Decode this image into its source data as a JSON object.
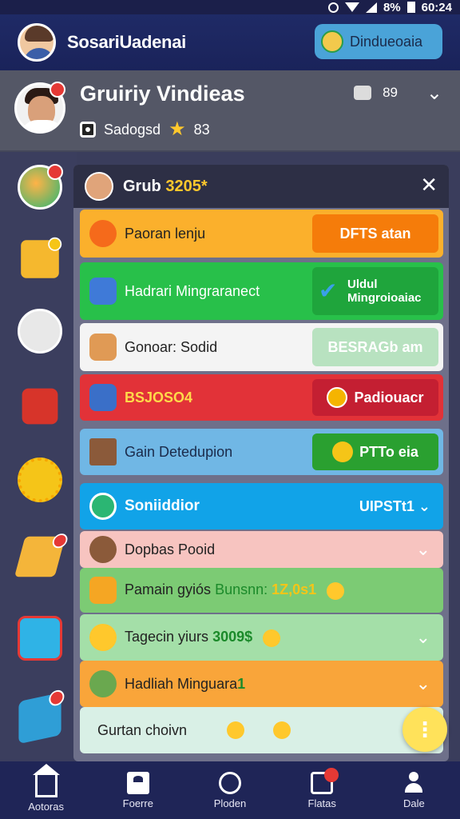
{
  "status_bar": {
    "battery": "8%",
    "time": "60:24"
  },
  "header": {
    "title": "SosariUadenai",
    "button_label": "Dindueoaia"
  },
  "profile": {
    "name": "Gruiriy Vindieas",
    "subtitle": "Sadogsd",
    "star_count": "83",
    "points": "89"
  },
  "panel": {
    "title_prefix": "Grub",
    "title_value": "3205*",
    "rows": [
      {
        "label": "Paoran lenju",
        "action": "DFTS atan"
      },
      {
        "label": "Hadrari Mingraranect",
        "action": "Uldul Mingroioaiac"
      },
      {
        "label": "Gonoar: Sodid",
        "action": "BESRAGb am"
      },
      {
        "label": "BSJOSO4",
        "action": "Padiouacr"
      },
      {
        "label": "Gain Detedupion",
        "action": "PTTo eia"
      },
      {
        "label": "Soniiddior",
        "action": "UIPSTt1"
      },
      {
        "label": "Dopbas Pooid"
      },
      {
        "label": "Pamain gyiós",
        "extra": "Bunsnn:",
        "value": "1Z,0s1"
      },
      {
        "label": "Tagecin yiurs",
        "value": "3009$"
      },
      {
        "label": "Hadliah Minguara",
        "value": "1"
      },
      {
        "label": "Gurtan choivn"
      }
    ]
  },
  "bottom_nav": [
    {
      "label": "Aotoras",
      "icon": "home-icon"
    },
    {
      "label": "Foerre",
      "icon": "document-icon"
    },
    {
      "label": "Ploden",
      "icon": "clock-icon"
    },
    {
      "label": "Flatas",
      "icon": "inbox-icon"
    },
    {
      "label": "Dale",
      "icon": "user-icon"
    }
  ],
  "fab_label": "⋮",
  "colors": {
    "header_bg": "#1f2a66",
    "accent_orange": "#f57c0a",
    "accent_green": "#28c04a",
    "accent_red": "#e23238",
    "nav_bg": "#1f2557"
  }
}
